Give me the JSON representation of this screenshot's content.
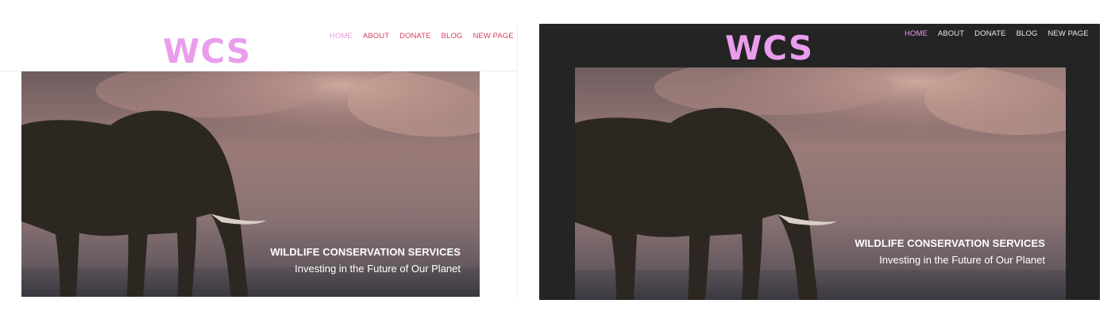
{
  "site": {
    "logo": "WCS",
    "nav": [
      "HOME",
      "ABOUT",
      "DONATE",
      "BLOG",
      "NEW PAGE"
    ],
    "hero": {
      "title": "WILDLIFE CONSERVATION SERVICES",
      "subtitle": "Investing in the Future of Our Planet",
      "image": "elephant-silhouette-at-dusk"
    }
  },
  "colors": {
    "logo": "#ea9ded",
    "nav_light": "#d23f5e",
    "nav_active_light": "#e8a0d8",
    "nav_dark": "#e9e9e9",
    "nav_active_dark": "#e89eea",
    "dark_background": "#242424"
  }
}
